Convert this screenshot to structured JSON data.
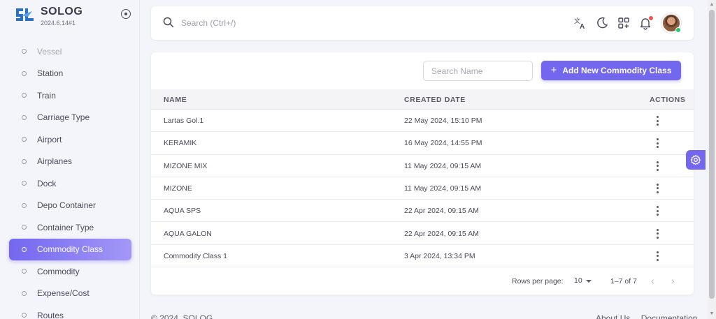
{
  "brand": {
    "name": "SOLOG",
    "version": "2024.6.14#1"
  },
  "sidebar": {
    "items": [
      {
        "label": "Vessel",
        "state": "faded"
      },
      {
        "label": "Station",
        "state": ""
      },
      {
        "label": "Train",
        "state": ""
      },
      {
        "label": "Carriage Type",
        "state": ""
      },
      {
        "label": "Airport",
        "state": ""
      },
      {
        "label": "Airplanes",
        "state": ""
      },
      {
        "label": "Dock",
        "state": ""
      },
      {
        "label": "Depo Container",
        "state": ""
      },
      {
        "label": "Container Type",
        "state": ""
      },
      {
        "label": "Commodity Class",
        "state": "active"
      },
      {
        "label": "Commodity",
        "state": ""
      },
      {
        "label": "Expense/Cost",
        "state": ""
      },
      {
        "label": "Routes",
        "state": ""
      }
    ]
  },
  "topbar": {
    "search_placeholder": "Search (Ctrl+/)",
    "icons": [
      "translate-icon",
      "dark-mode-icon",
      "apps-icon",
      "notifications-icon"
    ]
  },
  "toolbar": {
    "search_placeholder": "Search Name",
    "add_label": "Add New Commodity Class"
  },
  "table": {
    "headers": {
      "name": "NAME",
      "created": "CREATED DATE",
      "actions": "ACTIONS"
    },
    "rows": [
      {
        "name": "Lartas Gol.1",
        "created": "22 May 2024, 15:10 PM"
      },
      {
        "name": "KERAMIK",
        "created": "16 May 2024, 14:55 PM"
      },
      {
        "name": "MIZONE MIX",
        "created": "11 May 2024, 09:15 AM"
      },
      {
        "name": "MIZONE",
        "created": "11 May 2024, 09:15 AM"
      },
      {
        "name": "AQUA SPS",
        "created": "22 Apr 2024, 09:15 AM"
      },
      {
        "name": "AQUA GALON",
        "created": "22 Apr 2024, 09:15 AM"
      },
      {
        "name": "Commodity Class 1",
        "created": "3 Apr 2024, 13:34 PM"
      }
    ]
  },
  "pagination": {
    "rows_per_page_label": "Rows per page:",
    "rows_per_page": "10",
    "range": "1–7 of 7"
  },
  "footer": {
    "copyright": "© 2024, SOLOG",
    "links": [
      "About Us",
      "Documentation"
    ]
  },
  "colors": {
    "accent": "#7367f0",
    "online": "#28c76f",
    "notification": "#ea5455"
  }
}
